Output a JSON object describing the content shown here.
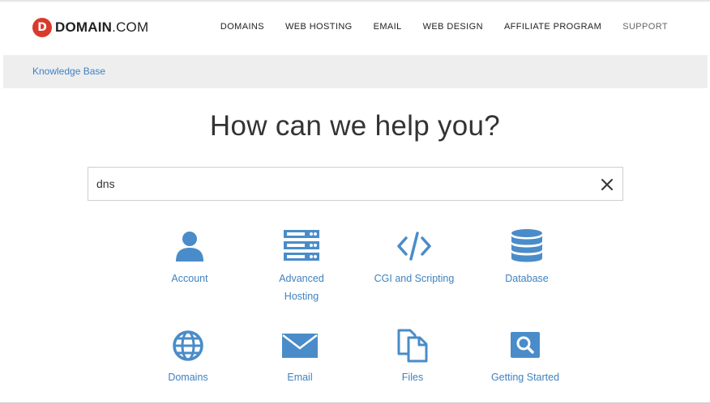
{
  "brand": {
    "logo_letter": "D",
    "name_bold": "DOMAIN",
    "name_light": ".COM"
  },
  "nav": [
    {
      "label": "DOMAINS"
    },
    {
      "label": "WEB HOSTING"
    },
    {
      "label": "EMAIL"
    },
    {
      "label": "WEB DESIGN"
    },
    {
      "label": "AFFILIATE PROGRAM"
    },
    {
      "label": "SUPPORT"
    }
  ],
  "breadcrumb": {
    "label": "Knowledge Base"
  },
  "hero": {
    "title": "How can we help you?"
  },
  "search": {
    "value": "dns",
    "clear_icon": "close-icon"
  },
  "categories": [
    {
      "label": "Account",
      "icon": "user-icon"
    },
    {
      "label": "Advanced Hosting",
      "icon": "server-icon"
    },
    {
      "label": "CGI and Scripting",
      "icon": "code-icon"
    },
    {
      "label": "Database",
      "icon": "database-icon"
    },
    {
      "label": "Domains",
      "icon": "globe-icon"
    },
    {
      "label": "Email",
      "icon": "envelope-icon"
    },
    {
      "label": "Files",
      "icon": "files-icon"
    },
    {
      "label": "Getting Started",
      "icon": "search-box-icon"
    }
  ],
  "colors": {
    "accent": "#3f82c0",
    "icon": "#4a8cc9",
    "logo": "#d93a2b",
    "bar": "#eeeeef"
  }
}
